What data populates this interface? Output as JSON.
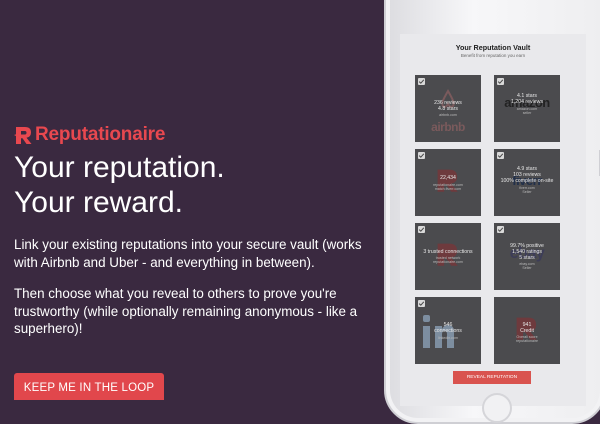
{
  "brand": {
    "name": "Reputationaire",
    "accent": "#e8484f"
  },
  "hero": {
    "headline_line1": "Your reputation.",
    "headline_line2": "Your reward.",
    "paragraph1": "Link your existing reputations into your secure vault (works with Airbnb and Uber - and everything in between).",
    "paragraph2": "Then choose what you reveal to others to prove you're trustworthy (while optionally remaining anonymous - like a superhero)!",
    "cta_label": "KEEP ME IN THE LOOP"
  },
  "phone_app": {
    "title": "Your Reputation Vault",
    "subtitle": "Benefit from reputation you earn",
    "reveal_button": "REVEAL REPUTATION",
    "tiles": [
      {
        "brand": "airbnb",
        "stat": "236 reviews\n4.8 stars",
        "sub": "airbnb.com"
      },
      {
        "brand": "amazon",
        "stat": "4.1 stars\n1,204 reviews",
        "sub": "amazon.com\nseller"
      },
      {
        "brand": "reputationaire",
        "stat": "22,434",
        "sub": "reputationaire.com\nmatch.fiverr.com"
      },
      {
        "brand": "fiverr",
        "stat": "4.9 stars\n103 reviews\n100% complete on-site",
        "sub": "fiverr.com\nSeller"
      },
      {
        "brand": "reputationaire",
        "stat": "3 trusted connections",
        "sub": "trusted network\nreputationaire.com"
      },
      {
        "brand": "ebay",
        "stat": "99.7% positive\n1,540 ratings\n5 stars",
        "sub": "ebay.com\nSeller"
      },
      {
        "brand": "linkedin",
        "stat": "546\nconnections",
        "sub": "linkedin.com"
      },
      {
        "brand": "reputationaire",
        "stat": "941\nCredit",
        "sub": "Overall score\nreputationaire"
      }
    ]
  },
  "colors": {
    "background": "#3a2940",
    "accent": "#e1474c",
    "tile": "#4b4b4e"
  }
}
